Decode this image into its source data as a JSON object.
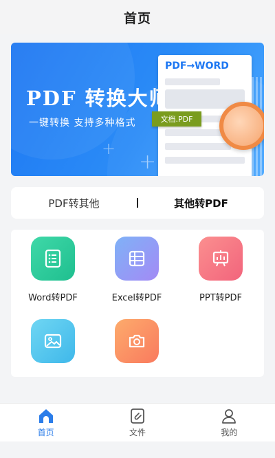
{
  "header": {
    "title": "首页"
  },
  "banner": {
    "title": "PDF 转换大师",
    "subtitle": "一键转换  支持多种格式",
    "doc_header": "PDF→WORD",
    "doc_tag": "文档.PDF",
    "accent": "#1d77f2"
  },
  "tabs": [
    {
      "label": "PDF转其他",
      "active": false
    },
    {
      "label": "其他转PDF",
      "active": true
    }
  ],
  "tools": [
    {
      "label": "Word转PDF",
      "icon": "list-document-icon",
      "color": "#27c79a"
    },
    {
      "label": "Excel转PDF",
      "icon": "table-icon",
      "color": "#8f8df6"
    },
    {
      "label": "PPT转PDF",
      "icon": "presentation-board-icon",
      "color": "#f46d7d"
    },
    {
      "label": "",
      "icon": "image-icon",
      "color": "#4cc5ee"
    },
    {
      "label": "",
      "icon": "camera-icon",
      "color": "#fb8c64"
    }
  ],
  "bottom_nav": [
    {
      "label": "首页",
      "icon": "home-icon",
      "active": true
    },
    {
      "label": "文件",
      "icon": "file-clip-icon",
      "active": false
    },
    {
      "label": "我的",
      "icon": "user-icon",
      "active": false
    }
  ]
}
